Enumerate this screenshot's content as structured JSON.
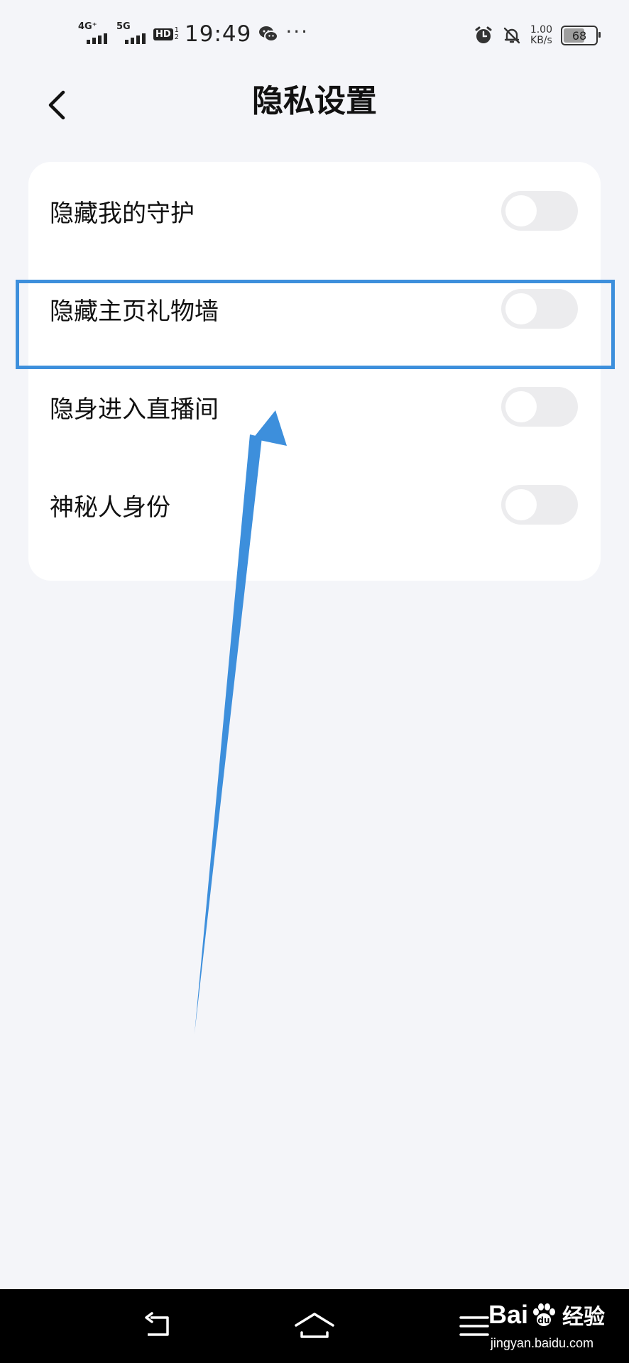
{
  "status_bar": {
    "signal1_tag": "4G⁺",
    "signal2_tag": "5G",
    "hd_label": "HD",
    "hd_nums": "1 2",
    "time": "19:49",
    "more": "···",
    "speed_value": "1.00",
    "speed_unit": "KB/s",
    "battery": "68",
    "battery_level_percent": 68
  },
  "header": {
    "title": "隐私设置"
  },
  "settings": [
    {
      "label": "隐藏我的守护",
      "enabled": false
    },
    {
      "label": "隐藏主页礼物墙",
      "enabled": false
    },
    {
      "label": "隐身进入直播间",
      "enabled": false
    },
    {
      "label": "神秘人身份",
      "enabled": false
    }
  ],
  "annotation": {
    "highlight_color": "#3d8fdc",
    "highlighted_item": "隐藏主页礼物墙"
  },
  "watermark": {
    "logo_text_left": "Bai",
    "logo_text_right": "经验",
    "url": "jingyan.baidu.com"
  },
  "colors": {
    "background": "#f4f5f9",
    "card": "#ffffff",
    "toggle_off": "#ececee"
  }
}
